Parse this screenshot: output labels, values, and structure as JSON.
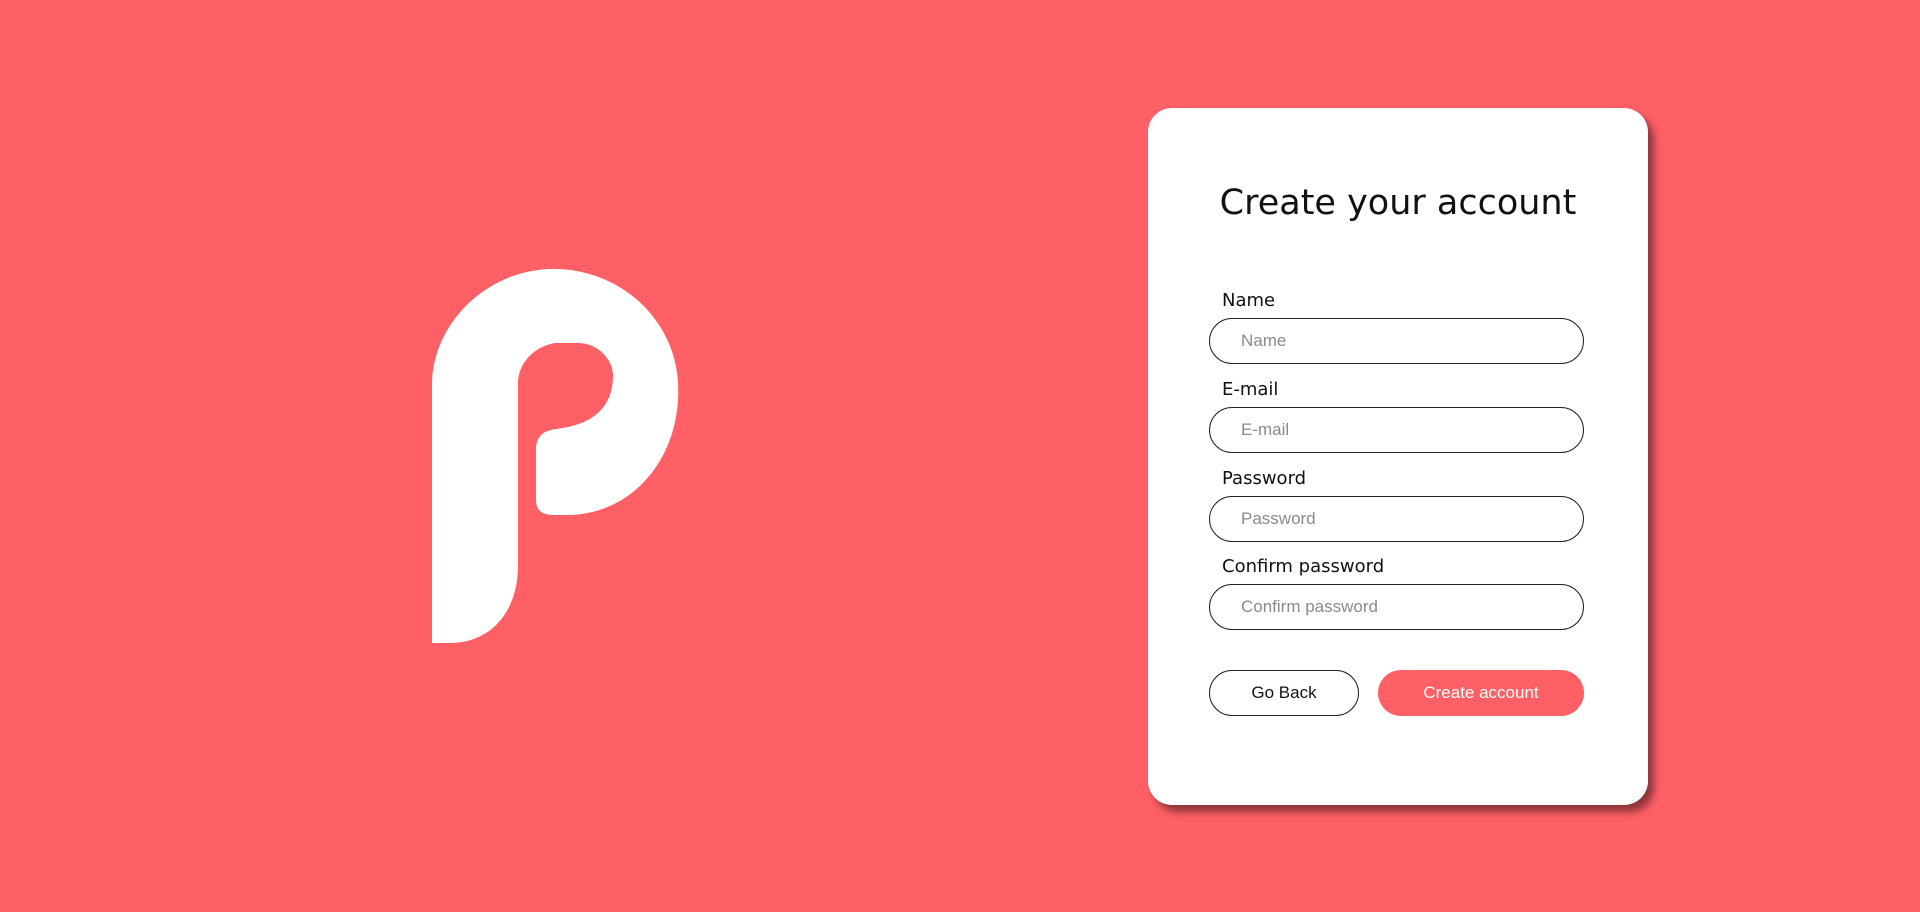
{
  "theme": {
    "background_color": "#ff6066",
    "accent_color": "#ff6066",
    "logo_color": "#ffffff",
    "logo_icon": "p-letter-logo-icon"
  },
  "signup": {
    "title": "Create your account",
    "fields": [
      {
        "label": "Name",
        "placeholder": "Name",
        "value": ""
      },
      {
        "label": "E-mail",
        "placeholder": "E-mail",
        "value": ""
      },
      {
        "label": "Password",
        "placeholder": "Password",
        "value": ""
      },
      {
        "label": "Confirm password",
        "placeholder": "Confirm password",
        "value": ""
      }
    ],
    "back_label": "Go Back",
    "create_label": "Create account"
  }
}
